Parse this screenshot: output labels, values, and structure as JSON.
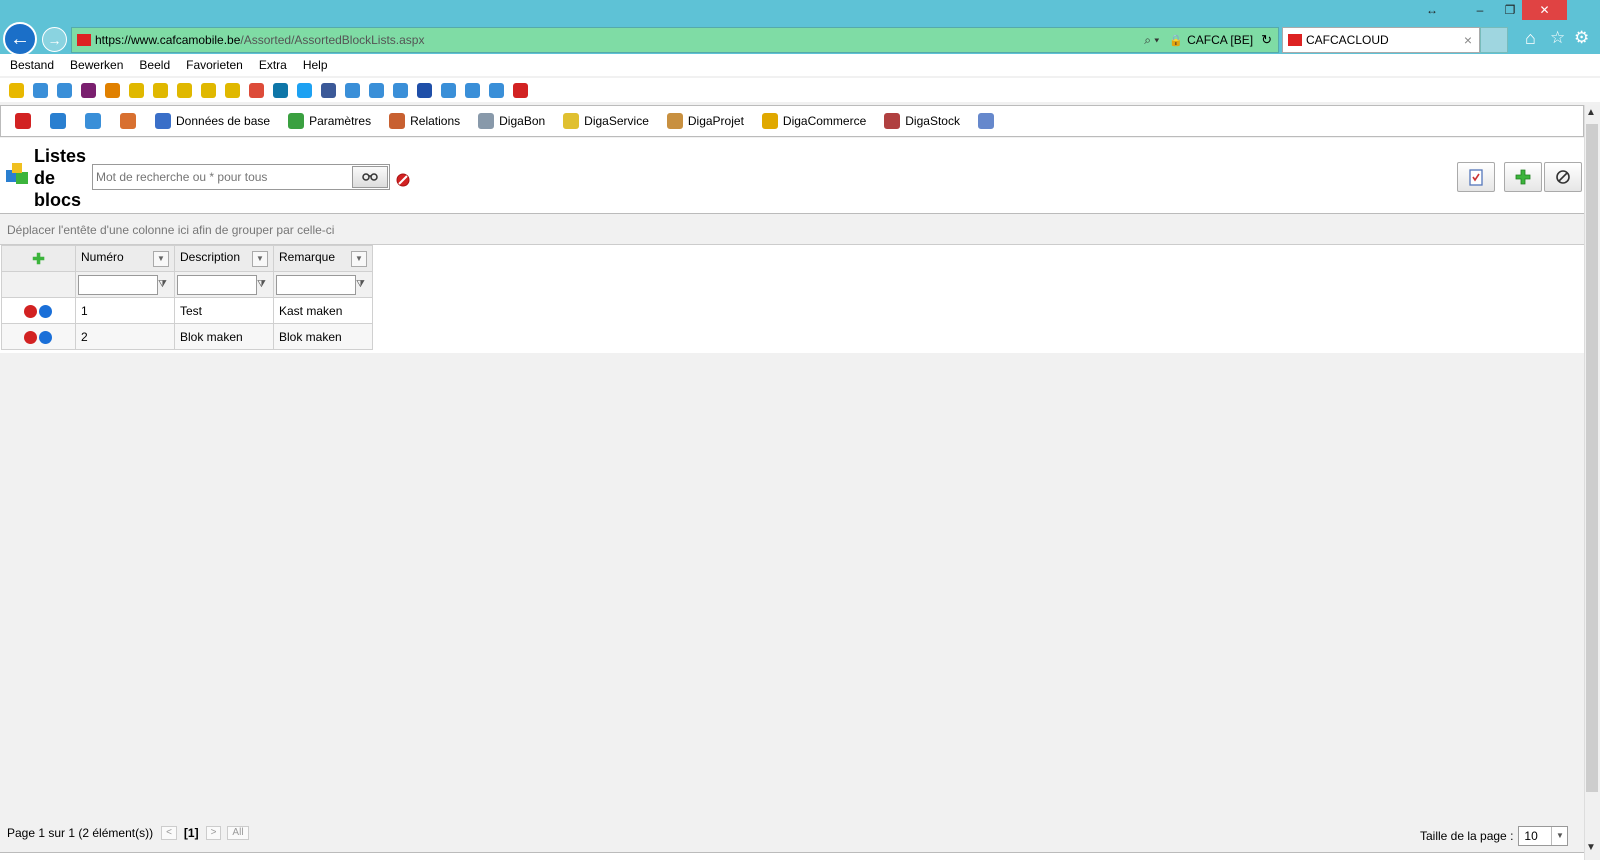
{
  "browser": {
    "url_host": "https://www.cafcamobile.be",
    "url_path": "/Assorted/AssortedBlockLists.aspx",
    "site_identity": "CAFCA [BE]",
    "tab_title": "CAFCACLOUD",
    "tab_close": "×",
    "window_buttons": {
      "resize": "↔",
      "minimize": "–",
      "restore": "❐",
      "close": "✕"
    },
    "back_glyph": "←",
    "forward_glyph": "→",
    "search_glyph": "⌕ ▾",
    "lock_glyph": "🔒",
    "refresh_glyph": "↻",
    "home_glyph": "⌂",
    "star_glyph": "☆",
    "gear_glyph": "⚙"
  },
  "menu": [
    "Bestand",
    "Bewerken",
    "Beeld",
    "Favorieten",
    "Extra",
    "Help"
  ],
  "favorites_icons": [
    {
      "name": "favorites-star-icon",
      "color": "#e8b800"
    },
    {
      "name": "ie-page-icon",
      "color": "#3a8fd8"
    },
    {
      "name": "ie-page-icon",
      "color": "#3a8fd8"
    },
    {
      "name": "h-logo-icon",
      "color": "#7a1f6f"
    },
    {
      "name": "flag-icon",
      "color": "#e08000"
    },
    {
      "name": "speedometer-icon",
      "color": "#e0b800"
    },
    {
      "name": "speedometer-icon",
      "color": "#e0b800"
    },
    {
      "name": "speedometer-icon",
      "color": "#e0b800"
    },
    {
      "name": "speedometer-icon",
      "color": "#e0b800"
    },
    {
      "name": "speedometer-icon",
      "color": "#e0b800"
    },
    {
      "name": "google-plus-icon",
      "color": "#dd4b39"
    },
    {
      "name": "linkedin-icon",
      "color": "#0e76a8"
    },
    {
      "name": "twitter-icon",
      "color": "#1da1f2"
    },
    {
      "name": "facebook-icon",
      "color": "#3b5998"
    },
    {
      "name": "ie-page-icon",
      "color": "#3a8fd8"
    },
    {
      "name": "ie-page-icon",
      "color": "#3a8fd8"
    },
    {
      "name": "ie-page-icon",
      "color": "#3a8fd8"
    },
    {
      "name": "globe-icon",
      "color": "#1f4fa8"
    },
    {
      "name": "ie-page-icon",
      "color": "#3a8fd8"
    },
    {
      "name": "ie-page-icon",
      "color": "#3a8fd8"
    },
    {
      "name": "ie-page-icon",
      "color": "#3a8fd8"
    },
    {
      "name": "cafca-icon",
      "color": "#d22222"
    }
  ],
  "toolbar": {
    "items": [
      {
        "name": "cafca-logo-icon",
        "label": "",
        "color": "#d22222"
      },
      {
        "name": "globe-icon",
        "label": "",
        "color": "#2a7fd0"
      },
      {
        "name": "refresh-icon",
        "label": "",
        "color": "#3a8fd8"
      },
      {
        "name": "user-icon",
        "label": "",
        "color": "#d87030"
      },
      {
        "name": "database-icon",
        "label": "Données de base",
        "color": "#3a6fc8"
      },
      {
        "name": "settings-icon",
        "label": "Paramètres",
        "color": "#3aa040"
      },
      {
        "name": "relations-icon",
        "label": "Relations",
        "color": "#c86030"
      },
      {
        "name": "document-icon",
        "label": "DigaBon",
        "color": "#8899aa"
      },
      {
        "name": "service-icon",
        "label": "DigaService",
        "color": "#e0c030"
      },
      {
        "name": "project-icon",
        "label": "DigaProjet",
        "color": "#c89040"
      },
      {
        "name": "commerce-icon",
        "label": "DigaCommerce",
        "color": "#e0a800"
      },
      {
        "name": "stock-icon",
        "label": "DigaStock",
        "color": "#b04040"
      },
      {
        "name": "checklist-icon",
        "label": "",
        "color": "#6688cc"
      }
    ]
  },
  "page": {
    "title_lines": [
      "Listes",
      "de",
      "blocs"
    ],
    "search_placeholder": "Mot de recherche ou * pour tous",
    "group_hint": "Déplacer l'entête d'une colonne ici afin de grouper par celle-ci"
  },
  "grid": {
    "columns": [
      "Numéro",
      "Description",
      "Remarque"
    ],
    "rows": [
      {
        "numero": "1",
        "description": "Test",
        "remarque": "Kast maken"
      },
      {
        "numero": "2",
        "description": "Blok maken",
        "remarque": "Blok maken"
      }
    ],
    "add_glyph": "✚",
    "dropdown_glyph": "▼",
    "funnel_glyph": "⧩"
  },
  "pager": {
    "summary": "Page 1 sur 1 (2 élément(s))",
    "prev": "<",
    "current": "[1]",
    "next": ">",
    "all": "All",
    "page_size_label": "Taille de la page :",
    "page_size_value": "10"
  },
  "colors": {
    "chrome": "#5ec2d6",
    "address_bar": "#7fdca5",
    "add_green": "#3cb43c",
    "delete_red": "#d22222",
    "info_blue": "#1a6fd8"
  }
}
